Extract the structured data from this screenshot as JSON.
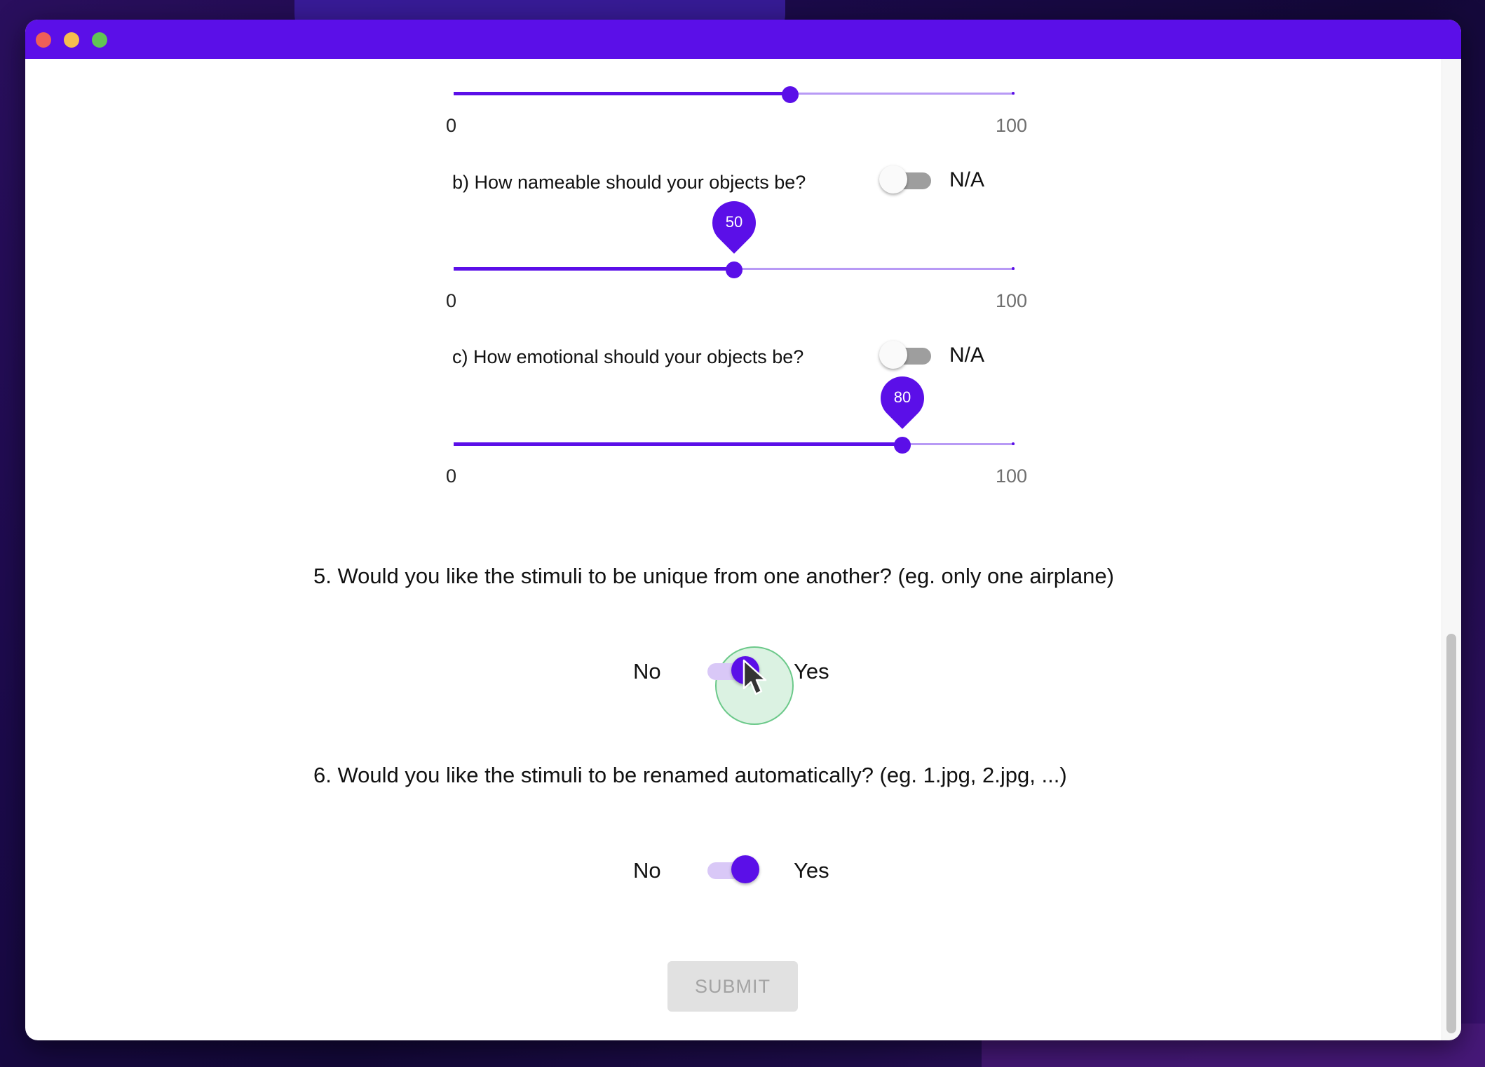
{
  "sliders": {
    "a": {
      "value": 60,
      "min_label": "0",
      "max_label": "100"
    },
    "b": {
      "question": "b) How nameable should your objects be?",
      "na_label": "N/A",
      "value": 50,
      "value_label": "50",
      "min_label": "0",
      "max_label": "100"
    },
    "c": {
      "question": "c) How emotional should your objects be?",
      "na_label": "N/A",
      "value": 80,
      "value_label": "80",
      "min_label": "0",
      "max_label": "100"
    }
  },
  "q5": {
    "question": "5. Would you like the stimuli to be unique from one another? (eg. only one airplane)",
    "no_label": "No",
    "yes_label": "Yes",
    "checked": true
  },
  "q6": {
    "question": "6. Would you like the stimuli to be renamed automatically? (eg. 1.jpg, 2.jpg, ...)",
    "no_label": "No",
    "yes_label": "Yes",
    "checked": true
  },
  "submit_label": "SUBMIT",
  "colors": {
    "accent": "#5b0fe8",
    "titlebar": "#5b0fe8",
    "rail_light": "#b89af5",
    "disabled_button": "#e1e1e1"
  },
  "icons": {
    "cursor": "arrow-cursor-icon",
    "window_close": "close-dot-icon",
    "window_minimize": "minimize-dot-icon",
    "window_zoom": "zoom-dot-icon"
  }
}
